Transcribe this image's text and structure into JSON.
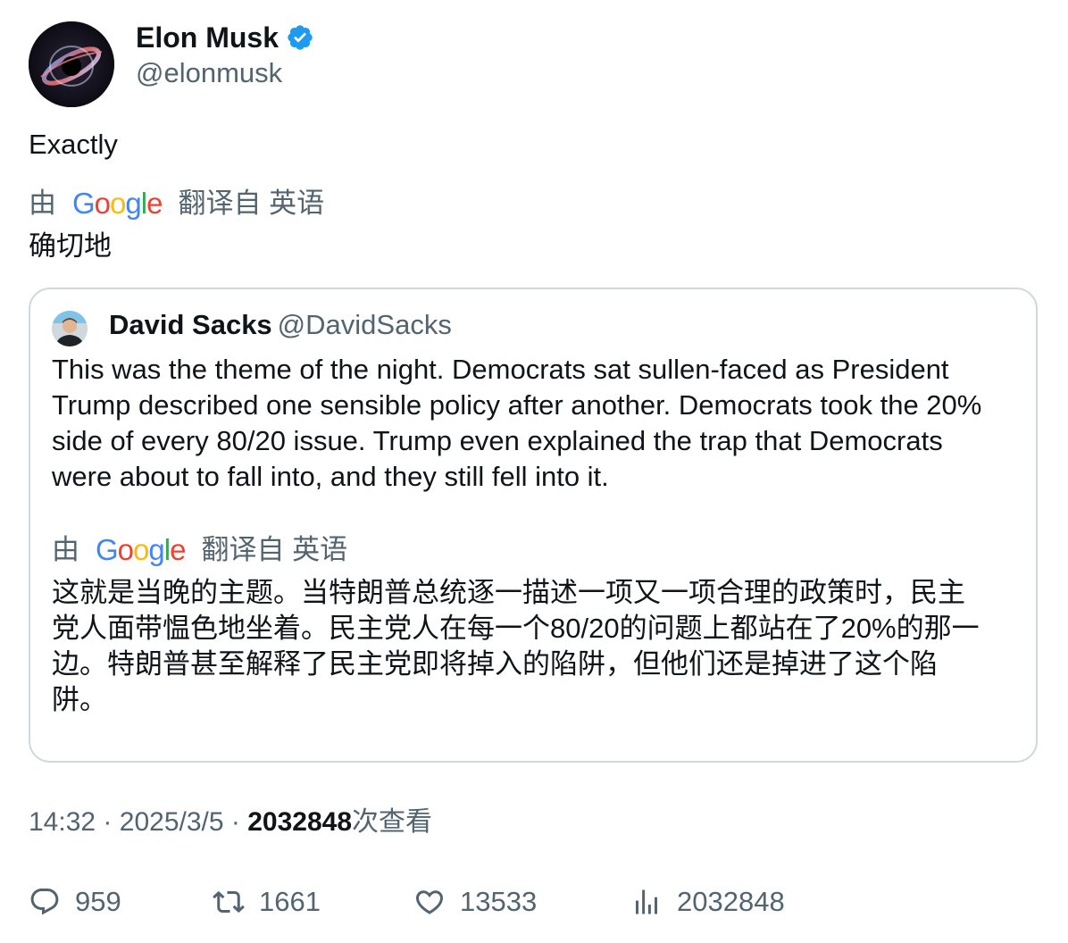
{
  "author": {
    "name": "Elon Musk",
    "handle": "@elonmusk",
    "verified_icon": "verified-badge-icon",
    "verified_color": "#1d9bf0"
  },
  "tweet": {
    "text": "Exactly",
    "translation": {
      "by": "由",
      "provider": "Google",
      "label": "翻译自 英语",
      "text": "确切地"
    }
  },
  "quote": {
    "name": "David Sacks",
    "handle": "@DavidSacks",
    "text_lines": [
      "This was the theme of the night. Democrats sat sullen-faced as President",
      "Trump described one sensible policy after another. Democrats took the 20%",
      "side of every 80/20 issue. Trump even explained the trap that Democrats",
      "were about to fall into, and they still fell into it."
    ],
    "translation": {
      "by": "由",
      "provider": "Google",
      "label": "翻译自 英语",
      "text_lines": [
        "这就是当晚的主题。当特朗普总统逐一描述一项又一项合理的政策时，民主",
        "党人面带愠色地坐着。民主党人在每一个80/20的问题上都站在了20%的那一",
        "边。特朗普甚至解释了民主党即将掉入的陷阱，但他们还是掉进了这个陷",
        "阱。"
      ]
    }
  },
  "meta": {
    "time": "14:32",
    "date": "2025/3/5",
    "separator": "·",
    "views": "2032848",
    "views_label": "次查看"
  },
  "actions": {
    "replies": "959",
    "retweets": "1661",
    "likes": "13533",
    "views": "2032848"
  },
  "colors": {
    "text_primary": "#0f1419",
    "text_secondary": "#536471",
    "border": "#cfd9de",
    "google_blue": "#4285f4",
    "google_red": "#ea4335",
    "google_yellow": "#fbbc05",
    "google_green": "#34a853"
  }
}
